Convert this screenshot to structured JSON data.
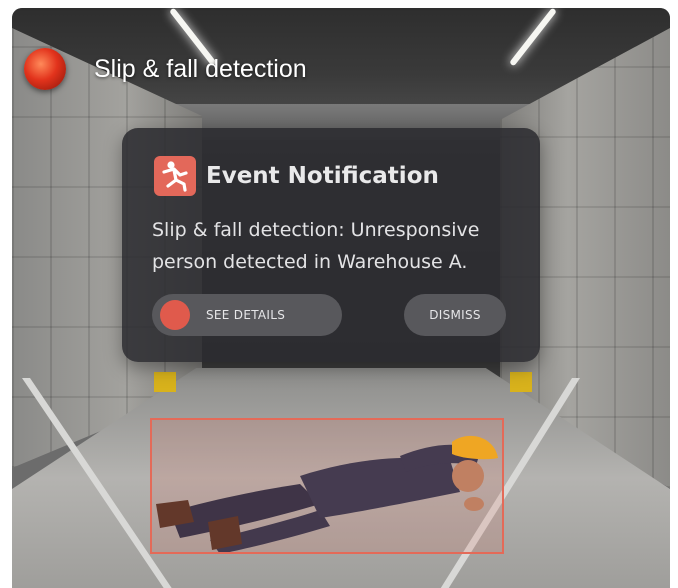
{
  "header": {
    "title": "Slip & fall detection",
    "status_icon": "recording-dot-icon",
    "status_color": "#e2331c"
  },
  "notification": {
    "icon": "person-falling-icon",
    "icon_color": "#e3685a",
    "title": "Event Notification",
    "message": "Slip & fall detection: Unresponsive person detected in Warehouse A.",
    "details_button": "SEE DETAILS",
    "dismiss_button": "DISMISS"
  },
  "detection": {
    "box_color": "#e46a58"
  }
}
